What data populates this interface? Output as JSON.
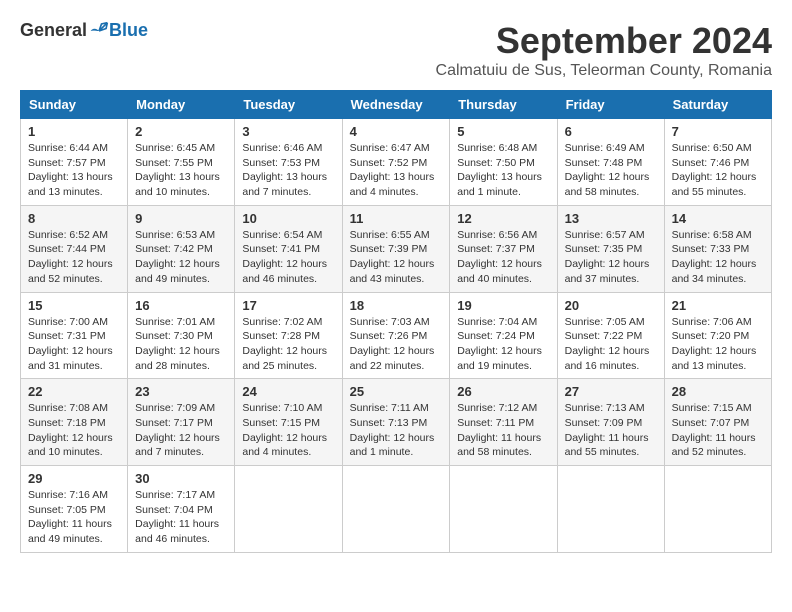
{
  "logo": {
    "general": "General",
    "blue": "Blue"
  },
  "header": {
    "title": "September 2024",
    "subtitle": "Calmatuiu de Sus, Teleorman County, Romania"
  },
  "weekdays": [
    "Sunday",
    "Monday",
    "Tuesday",
    "Wednesday",
    "Thursday",
    "Friday",
    "Saturday"
  ],
  "weeks": [
    [
      {
        "day": "1",
        "info": "Sunrise: 6:44 AM\nSunset: 7:57 PM\nDaylight: 13 hours\nand 13 minutes."
      },
      {
        "day": "2",
        "info": "Sunrise: 6:45 AM\nSunset: 7:55 PM\nDaylight: 13 hours\nand 10 minutes."
      },
      {
        "day": "3",
        "info": "Sunrise: 6:46 AM\nSunset: 7:53 PM\nDaylight: 13 hours\nand 7 minutes."
      },
      {
        "day": "4",
        "info": "Sunrise: 6:47 AM\nSunset: 7:52 PM\nDaylight: 13 hours\nand 4 minutes."
      },
      {
        "day": "5",
        "info": "Sunrise: 6:48 AM\nSunset: 7:50 PM\nDaylight: 13 hours\nand 1 minute."
      },
      {
        "day": "6",
        "info": "Sunrise: 6:49 AM\nSunset: 7:48 PM\nDaylight: 12 hours\nand 58 minutes."
      },
      {
        "day": "7",
        "info": "Sunrise: 6:50 AM\nSunset: 7:46 PM\nDaylight: 12 hours\nand 55 minutes."
      }
    ],
    [
      {
        "day": "8",
        "info": "Sunrise: 6:52 AM\nSunset: 7:44 PM\nDaylight: 12 hours\nand 52 minutes."
      },
      {
        "day": "9",
        "info": "Sunrise: 6:53 AM\nSunset: 7:42 PM\nDaylight: 12 hours\nand 49 minutes."
      },
      {
        "day": "10",
        "info": "Sunrise: 6:54 AM\nSunset: 7:41 PM\nDaylight: 12 hours\nand 46 minutes."
      },
      {
        "day": "11",
        "info": "Sunrise: 6:55 AM\nSunset: 7:39 PM\nDaylight: 12 hours\nand 43 minutes."
      },
      {
        "day": "12",
        "info": "Sunrise: 6:56 AM\nSunset: 7:37 PM\nDaylight: 12 hours\nand 40 minutes."
      },
      {
        "day": "13",
        "info": "Sunrise: 6:57 AM\nSunset: 7:35 PM\nDaylight: 12 hours\nand 37 minutes."
      },
      {
        "day": "14",
        "info": "Sunrise: 6:58 AM\nSunset: 7:33 PM\nDaylight: 12 hours\nand 34 minutes."
      }
    ],
    [
      {
        "day": "15",
        "info": "Sunrise: 7:00 AM\nSunset: 7:31 PM\nDaylight: 12 hours\nand 31 minutes."
      },
      {
        "day": "16",
        "info": "Sunrise: 7:01 AM\nSunset: 7:30 PM\nDaylight: 12 hours\nand 28 minutes."
      },
      {
        "day": "17",
        "info": "Sunrise: 7:02 AM\nSunset: 7:28 PM\nDaylight: 12 hours\nand 25 minutes."
      },
      {
        "day": "18",
        "info": "Sunrise: 7:03 AM\nSunset: 7:26 PM\nDaylight: 12 hours\nand 22 minutes."
      },
      {
        "day": "19",
        "info": "Sunrise: 7:04 AM\nSunset: 7:24 PM\nDaylight: 12 hours\nand 19 minutes."
      },
      {
        "day": "20",
        "info": "Sunrise: 7:05 AM\nSunset: 7:22 PM\nDaylight: 12 hours\nand 16 minutes."
      },
      {
        "day": "21",
        "info": "Sunrise: 7:06 AM\nSunset: 7:20 PM\nDaylight: 12 hours\nand 13 minutes."
      }
    ],
    [
      {
        "day": "22",
        "info": "Sunrise: 7:08 AM\nSunset: 7:18 PM\nDaylight: 12 hours\nand 10 minutes."
      },
      {
        "day": "23",
        "info": "Sunrise: 7:09 AM\nSunset: 7:17 PM\nDaylight: 12 hours\nand 7 minutes."
      },
      {
        "day": "24",
        "info": "Sunrise: 7:10 AM\nSunset: 7:15 PM\nDaylight: 12 hours\nand 4 minutes."
      },
      {
        "day": "25",
        "info": "Sunrise: 7:11 AM\nSunset: 7:13 PM\nDaylight: 12 hours\nand 1 minute."
      },
      {
        "day": "26",
        "info": "Sunrise: 7:12 AM\nSunset: 7:11 PM\nDaylight: 11 hours\nand 58 minutes."
      },
      {
        "day": "27",
        "info": "Sunrise: 7:13 AM\nSunset: 7:09 PM\nDaylight: 11 hours\nand 55 minutes."
      },
      {
        "day": "28",
        "info": "Sunrise: 7:15 AM\nSunset: 7:07 PM\nDaylight: 11 hours\nand 52 minutes."
      }
    ],
    [
      {
        "day": "29",
        "info": "Sunrise: 7:16 AM\nSunset: 7:05 PM\nDaylight: 11 hours\nand 49 minutes."
      },
      {
        "day": "30",
        "info": "Sunrise: 7:17 AM\nSunset: 7:04 PM\nDaylight: 11 hours\nand 46 minutes."
      },
      {
        "day": "",
        "info": ""
      },
      {
        "day": "",
        "info": ""
      },
      {
        "day": "",
        "info": ""
      },
      {
        "day": "",
        "info": ""
      },
      {
        "day": "",
        "info": ""
      }
    ]
  ]
}
